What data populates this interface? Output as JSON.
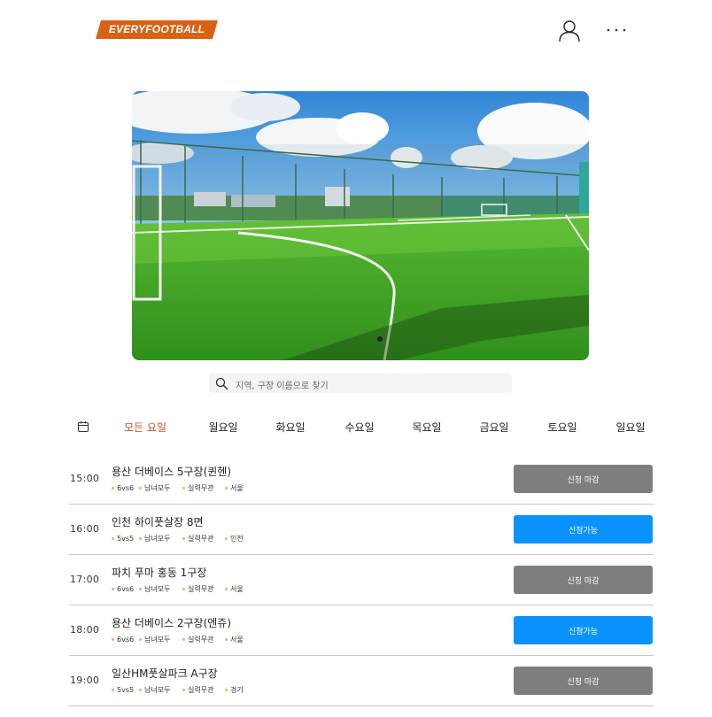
{
  "header": {
    "logo_text": "EVERYFOOTBALL",
    "logo_color": "#d96212",
    "user_icon": "user-icon",
    "more_icon": "more-dots-icon"
  },
  "hero": {
    "image": "artificial-turf-futsal-field-photo"
  },
  "search": {
    "placeholder": "지역, 구장 이름으로 찾기",
    "value": ""
  },
  "days": {
    "calendar_icon": "calendar-icon",
    "tabs": [
      {
        "label": "모든 요일",
        "active": true
      },
      {
        "label": "월요일",
        "active": false
      },
      {
        "label": "화요일",
        "active": false
      },
      {
        "label": "수요일",
        "active": false
      },
      {
        "label": "목요일",
        "active": false
      },
      {
        "label": "금요일",
        "active": false
      },
      {
        "label": "토요일",
        "active": false
      },
      {
        "label": "일요일",
        "active": false
      }
    ],
    "active_color": "#c0542a"
  },
  "matches": [
    {
      "time": "15:00",
      "title": "용산 더베이스 5구장(퀸헨)",
      "tags": [
        "6vs6",
        "남녀모두",
        "실력무관",
        "서울"
      ],
      "button": "신청 마감",
      "status": "closed"
    },
    {
      "time": "16:00",
      "title": "인천 하이풋살장 8면",
      "tags": [
        "5vs5",
        "남녀모두",
        "실력무관",
        "인천"
      ],
      "button": "신청가능",
      "status": "open"
    },
    {
      "time": "17:00",
      "title": "파치 푸마 홍동 1구장",
      "tags": [
        "6vs6",
        "남녀모두",
        "실력무관",
        "서울"
      ],
      "button": "신청 마감",
      "status": "closed"
    },
    {
      "time": "18:00",
      "title": "용산 더베이스 2구장(엔쥬)",
      "tags": [
        "6vs6",
        "남녀모두",
        "실력무관",
        "서울"
      ],
      "button": "신청가능",
      "status": "open"
    },
    {
      "time": "19:00",
      "title": "일산HM풋살파크 A구장",
      "tags": [
        "5vs5",
        "남녀모두",
        "실력무관",
        "경기"
      ],
      "button": "신청 마감",
      "status": "closed"
    }
  ],
  "colors": {
    "button_open": "#0a92ff",
    "button_closed": "#7e7e7e",
    "tag_dot": "#e8b84a"
  }
}
